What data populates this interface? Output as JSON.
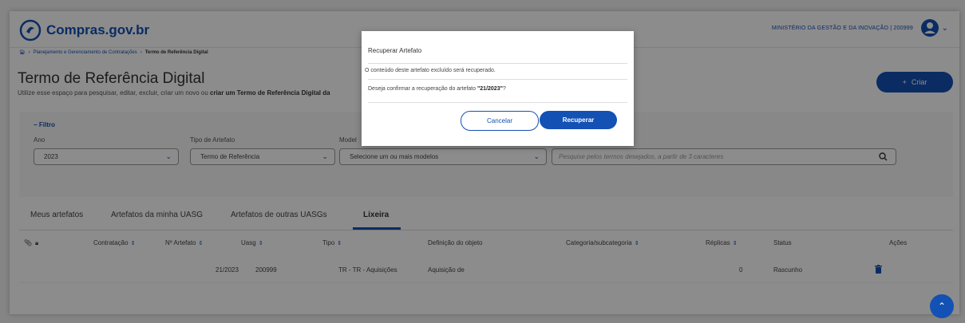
{
  "header": {
    "logo_text": "Compras.gov.br",
    "ministry": "MINISTÉRIO DA GESTÃO E DA INOVAÇÃO | 200999"
  },
  "breadcrumb": {
    "item1": "Planejamento e Gerenciamento de Contratações",
    "item2": "Termo de Referência Digital"
  },
  "page": {
    "title": "Termo de Referência Digital",
    "description_prefix": "Utilize esse espaço para pesquisar, editar, excluir, criar um novo ou ",
    "description_bold": "criar um Termo de Referência Digital da",
    "create_button": "Criar"
  },
  "filter": {
    "label": "Filtro",
    "year_label": "Ano",
    "year_value": "2023",
    "type_label": "Tipo de Artefato",
    "type_value": "Termo de Referência",
    "model_label": "Model",
    "model_value": "Selecione um ou mais modelos",
    "search_placeholder": "Pesquise pelos termos desejados, a partir de 3 caracteres"
  },
  "tabs": [
    "Meus artefatos",
    "Artefatos da minha UASG",
    "Artefatos de outras UASGs",
    "Lixeira"
  ],
  "table": {
    "headers": {
      "contratacao": "Contratação",
      "numero": "Nº Artefato",
      "uasg": "Uasg",
      "tipo": "Tipo",
      "definicao": "Definição do objeto",
      "categoria": "Categoria/subcategoria",
      "replicas": "Réplicas",
      "status": "Status",
      "acoes": "Ações"
    },
    "rows": [
      {
        "numero": "21/2023",
        "uasg": "200999",
        "tipo": "TR - TR - Aquisições",
        "definicao": "Aquisição de",
        "replicas": "0",
        "status": "Rascunho"
      }
    ]
  },
  "modal": {
    "title": "Recuperar Artefato",
    "text1": "O conteúdo deste artefato excluído será recuperado.",
    "text2_prefix": "Deseja confirmar a recuperação do artefato ",
    "text2_bold": "\"21/2023\"",
    "text2_suffix": "?",
    "cancel": "Cancelar",
    "confirm": "Recuperar"
  },
  "colors": {
    "primary": "#1351b4"
  }
}
